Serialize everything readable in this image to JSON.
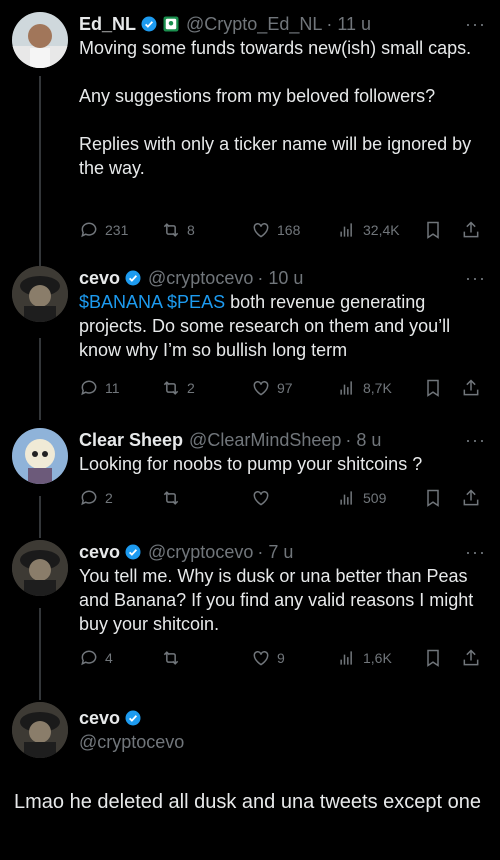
{
  "tweets": [
    {
      "name": "Ed_NL",
      "handle": "@Crypto_Ed_NL",
      "time": "· 11 u",
      "text": "Moving some funds towards new(ish) small caps.\n\nAny suggestions from my beloved followers?\n\nReplies with only a ticker name will be ignored by the way.",
      "replies": "231",
      "retweets": "8",
      "likes": "168",
      "views": "32,4K"
    },
    {
      "name": "cevo",
      "handle": "@cryptocevo",
      "time": "· 10 u",
      "text_cashtags": "$BANANA $PEAS",
      "text_rest": " both revenue generating projects. Do some research on them and you’ll know why I’m so bullish long term",
      "replies": "11",
      "retweets": "2",
      "likes": "97",
      "views": "8,7K"
    },
    {
      "name": "Clear Sheep",
      "handle": "@ClearMindSheep",
      "time": "· 8 u",
      "text": "Looking for noobs to pump your shitcoins ?",
      "replies": "2",
      "retweets": "",
      "likes": "",
      "views": "509"
    },
    {
      "name": "cevo",
      "handle": "@cryptocevo",
      "time": "· 7 u",
      "text": "You tell me. Why is dusk or una better than Peas and Banana? If you find any valid reasons I might buy your shitcoin.",
      "replies": "4",
      "retweets": "",
      "likes": "9",
      "views": "1,6K"
    }
  ],
  "profile": {
    "name": "cevo",
    "handle": "@cryptocevo"
  },
  "caption": "Lmao he deleted all dusk and una tweets except one",
  "colors": {
    "background": "#000000",
    "text": "#e7e9ea",
    "muted": "#71767b",
    "accent": "#1d9bf0"
  }
}
